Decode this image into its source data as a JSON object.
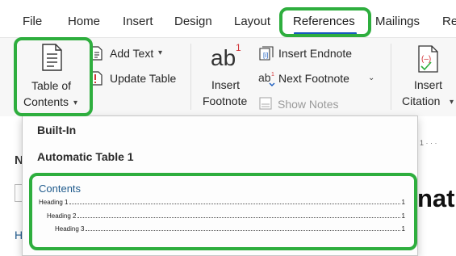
{
  "tabs": [
    "File",
    "Home",
    "Insert",
    "Design",
    "Layout",
    "References",
    "Mailings",
    "Re"
  ],
  "ribbon": {
    "toc_line1": "Table of",
    "toc_line2": "Contents",
    "add_text": "Add Text",
    "update_table": "Update Table",
    "ab_glyph": "ab",
    "ab_superscript": "1",
    "insert_footnote_line1": "Insert",
    "insert_footnote_line2": "Footnote",
    "insert_endnote": "Insert Endnote",
    "next_footnote": "Next Footnote",
    "show_notes": "Show Notes",
    "insert_citation_line1": "Insert",
    "insert_citation_line2": "Citation"
  },
  "dropdown": {
    "section": "Built-In",
    "option": "Automatic Table 1",
    "preview": {
      "title": "Contents",
      "entries": [
        {
          "label": "Heading 1",
          "page": "1"
        },
        {
          "label": "Heading 2",
          "page": "1"
        },
        {
          "label": "Heading 3",
          "page": "1"
        }
      ]
    }
  },
  "document": {
    "ruler_marks": "1 · · ·",
    "partial_n": "N",
    "partial_h": "H",
    "partial_text": "natu"
  },
  "colors": {
    "highlight": "#2eae3e",
    "accent": "#185abd",
    "toc_title": "#1f5a8c"
  }
}
